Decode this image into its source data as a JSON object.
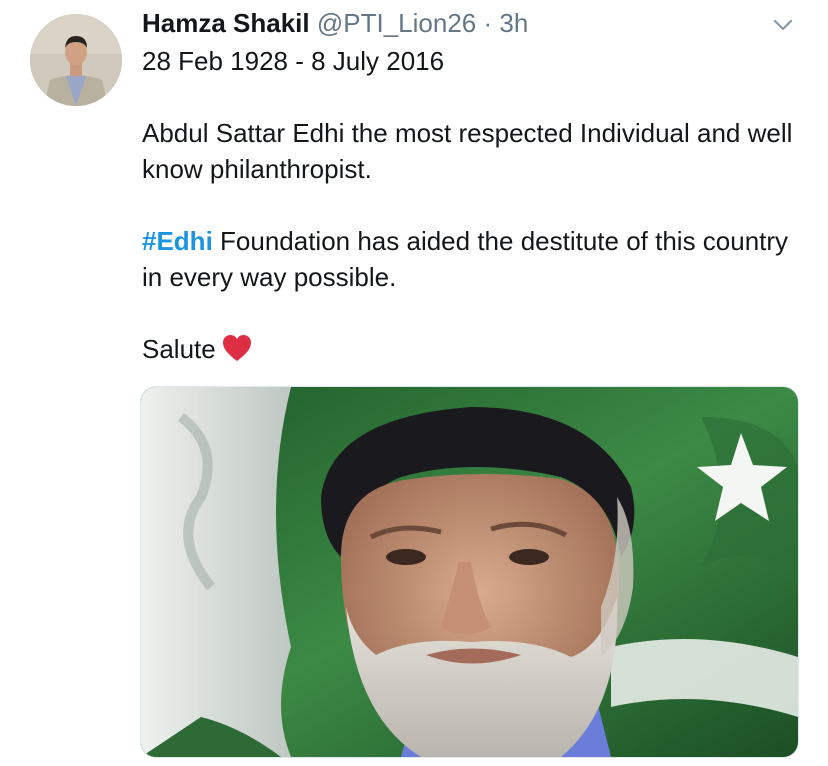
{
  "tweet": {
    "author_name": "Hamza Shakil",
    "handle": "@PTI_Lion26",
    "separator": "·",
    "time": "3h",
    "dates_line": "28 Feb 1928 - 8 July 2016",
    "paragraph1": "Abdul Sattar Edhi the most respected Individual and well know philanthropist.",
    "hashtag": "#Edhi",
    "paragraph2_rest": " Foundation has aided the destitute of this country in every way possible.",
    "salute": "Salute",
    "heart_icon": "red-heart-icon",
    "hashtag_color": "#1b95e0"
  }
}
